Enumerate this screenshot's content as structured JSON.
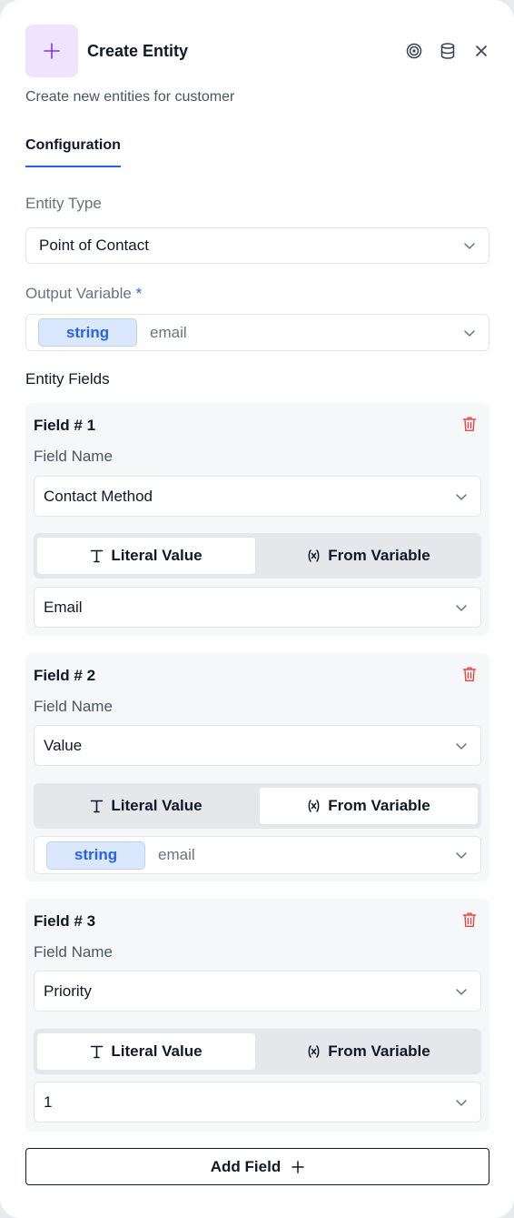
{
  "header": {
    "title": "Create Entity",
    "subtitle": "Create new entities for customer",
    "accent": "#7c3aed",
    "icon_bg": "#efe3fd"
  },
  "tabs": [
    {
      "label": "Configuration",
      "active": true
    }
  ],
  "entity_type": {
    "label": "Entity Type",
    "value": "Point of Contact"
  },
  "output_variable": {
    "label": "Output Variable",
    "required_marker": "*",
    "type": "string",
    "placeholder": "email"
  },
  "entity_fields": {
    "title": "Entity Fields",
    "fields": [
      {
        "title": "Field # 1",
        "name_label": "Field Name",
        "name_value": "Contact Method",
        "modes": {
          "literal": "Literal Value",
          "variable": "From Variable"
        },
        "active_mode": "literal",
        "value": "Email"
      },
      {
        "title": "Field # 2",
        "name_label": "Field Name",
        "name_value": "Value",
        "modes": {
          "literal": "Literal Value",
          "variable": "From Variable"
        },
        "active_mode": "variable",
        "variable_type": "string",
        "variable_placeholder": "email"
      },
      {
        "title": "Field # 3",
        "name_label": "Field Name",
        "name_value": "Priority",
        "modes": {
          "literal": "Literal Value",
          "variable": "From Variable"
        },
        "active_mode": "literal",
        "value": "1"
      }
    ]
  },
  "add_field_label": "Add Field",
  "colors": {
    "primary": "#2563eb",
    "danger": "#ef4444",
    "pill_bg": "#dbe7fd"
  }
}
